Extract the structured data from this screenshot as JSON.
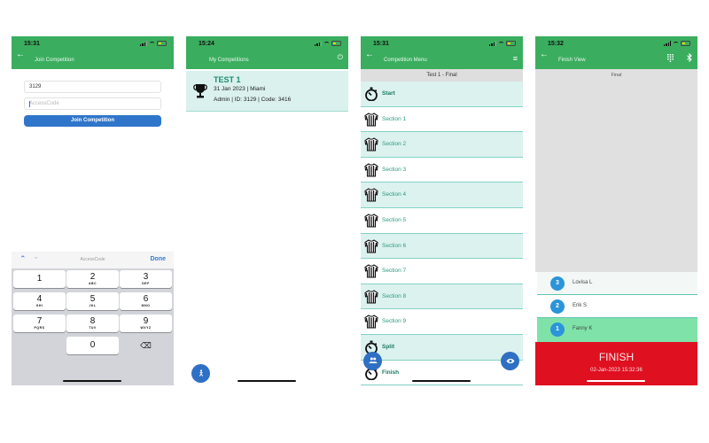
{
  "screens": {
    "join": {
      "status_time": "15:31",
      "title": "Join Competition",
      "competition_id_value": "3129",
      "access_code_placeholder": "AccessCode",
      "join_button": "Join Competition",
      "keyboard": {
        "toolbar_label": "AccessCode",
        "done": "Done",
        "keys": [
          {
            "digit": "1",
            "letters": ""
          },
          {
            "digit": "2",
            "letters": "ABC"
          },
          {
            "digit": "3",
            "letters": "DEF"
          },
          {
            "digit": "4",
            "letters": "GHI"
          },
          {
            "digit": "5",
            "letters": "JKL"
          },
          {
            "digit": "6",
            "letters": "MNO"
          },
          {
            "digit": "7",
            "letters": "PQRS"
          },
          {
            "digit": "8",
            "letters": "TUV"
          },
          {
            "digit": "9",
            "letters": "WXYZ"
          },
          {
            "digit": "0",
            "letters": ""
          }
        ],
        "delete_icon": "⌫"
      }
    },
    "my_competitions": {
      "status_time": "15:24",
      "title": "My Competitions",
      "power_icon": "⏻",
      "competition": {
        "name": "TEST 1",
        "date_location": "31 Jan 2023 | Miami",
        "details": "Admin | ID: 3129 |  Code: 3416"
      },
      "fab_icon": "person-icon"
    },
    "competition_menu": {
      "status_time": "15:31",
      "title": "Competition Menu",
      "subheader": "Test 1 - Final",
      "items": [
        {
          "label": "Start",
          "icon": "stopwatch"
        },
        {
          "label": "Section 1",
          "icon": "jersey"
        },
        {
          "label": "Section 2",
          "icon": "jersey"
        },
        {
          "label": "Section 3",
          "icon": "jersey"
        },
        {
          "label": "Section 4",
          "icon": "jersey"
        },
        {
          "label": "Section 5",
          "icon": "jersey"
        },
        {
          "label": "Section 6",
          "icon": "jersey"
        },
        {
          "label": "Section 7",
          "icon": "jersey"
        },
        {
          "label": "Section 8",
          "icon": "jersey"
        },
        {
          "label": "Section 9",
          "icon": "jersey"
        },
        {
          "label": "Split",
          "icon": "stopwatch"
        },
        {
          "label": "Finish",
          "icon": "stopwatch"
        }
      ]
    },
    "finish_view": {
      "status_time": "15:32",
      "title": "Finish View",
      "subheader": "Final",
      "results": [
        {
          "rank": "3",
          "name": "Lovisa L"
        },
        {
          "rank": "2",
          "name": "Erik S"
        },
        {
          "rank": "1",
          "name": "Fanny K"
        }
      ],
      "finish_label": "FINISH",
      "finish_time": "02-Jan-2023 15:32:36"
    }
  },
  "colors": {
    "appbar_green": "#3aae5e",
    "primary_blue": "#2f75c9",
    "teal_text": "#2b9a80",
    "row_alt": "#dcf2ef",
    "winner_row": "#7fe3a9",
    "finish_red": "#df1020"
  }
}
